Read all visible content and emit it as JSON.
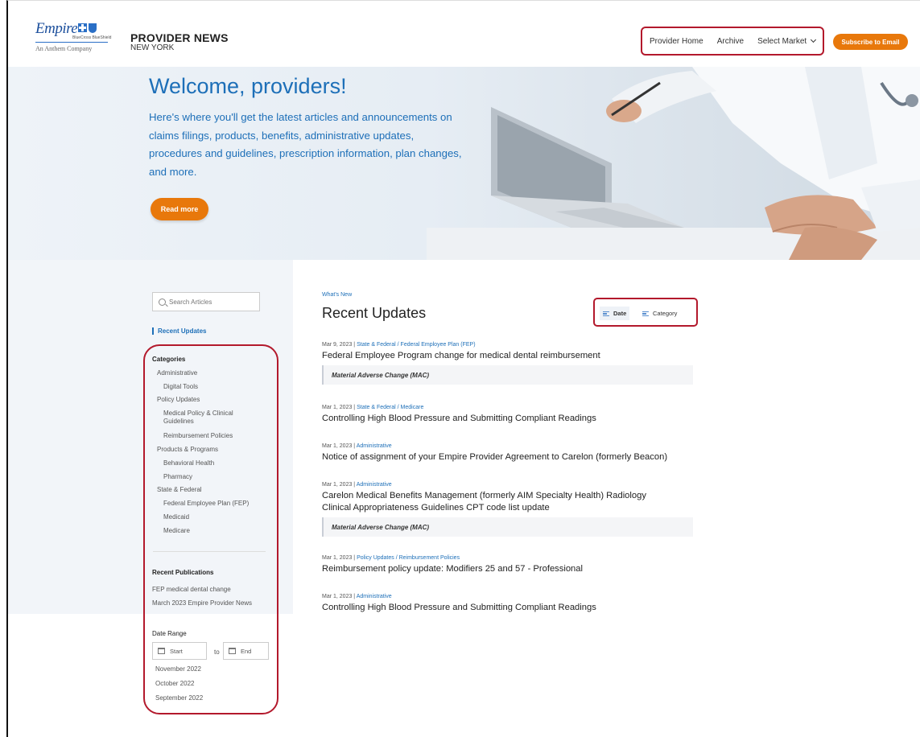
{
  "header": {
    "logo": {
      "wordmark": "Empire",
      "sub": "BlueCross BlueShield",
      "tagline": "An Anthem Company"
    },
    "title": "PROVIDER NEWS",
    "subtitle": "NEW YORK",
    "nav": {
      "home": "Provider Home",
      "archive": "Archive",
      "market": "Select Market"
    },
    "subscribe_label": "Subscribe to Email"
  },
  "hero": {
    "title": "Welcome, providers!",
    "text": "Here's where you'll get the latest articles and announcements on claims filings, products, benefits, administrative updates, procedures and guidelines, prescription information, plan changes, and more.",
    "button": "Read more"
  },
  "sidebar": {
    "search_placeholder": "Search Articles",
    "recent_updates": "Recent Updates",
    "categories_heading": "Categories",
    "categories": {
      "administrative": "Administrative",
      "digital_tools": "Digital Tools",
      "policy_updates": "Policy Updates",
      "medical_policy_line1": "Medical Policy & Clinical",
      "medical_policy_line2": "Guidelines",
      "reimbursement": "Reimbursement Policies",
      "products": "Products & Programs",
      "behavioral": "Behavioral Health",
      "pharmacy": "Pharmacy",
      "state_federal": "State & Federal",
      "fep": "Federal Employee Plan (FEP)",
      "medicaid": "Medicaid",
      "medicare": "Medicare"
    },
    "publications_heading": "Recent Publications",
    "publications": [
      "FEP medical dental change",
      "March 2023 Empire Provider News"
    ],
    "date_range_heading": "Date Range",
    "start_placeholder": "Start",
    "to_label": "to",
    "end_placeholder": "End",
    "months": [
      "November 2022",
      "October 2022",
      "September 2022"
    ]
  },
  "main": {
    "breadcrumb": "What's New",
    "title": "Recent Updates",
    "sort": {
      "date": "Date",
      "category": "Category"
    },
    "articles": [
      {
        "date": "Mar 9, 2023 | ",
        "category": "State & Federal / Federal Employee Plan (FEP)",
        "title": "Federal Employee Program change for medical dental reimbursement",
        "tag": "Material Adverse Change (MAC)"
      },
      {
        "date": "Mar 1, 2023 | ",
        "category": "State & Federal / Medicare",
        "title": "Controlling High Blood Pressure and Submitting Compliant Readings"
      },
      {
        "date": "Mar 1, 2023 | ",
        "category": "Administrative",
        "title": "Notice of assignment of your Empire Provider Agreement to Carelon (formerly Beacon)"
      },
      {
        "date": "Mar 1, 2023 | ",
        "category": "Administrative",
        "title_line1": "Carelon Medical Benefits Management (formerly AIM Specialty Health) Radiology",
        "title_line2": "Clinical Appropriateness Guidelines CPT code list update",
        "tag": "Material Adverse Change (MAC)"
      },
      {
        "date": "Mar 1, 2023 | ",
        "category": "Policy Updates / Reimbursement Policies",
        "title": "Reimbursement policy update: Modifiers 25 and 57 - Professional"
      },
      {
        "date": "Mar 1, 2023 | ",
        "category": "Administrative",
        "title": "Controlling High Blood Pressure and Submitting Compliant Readings"
      }
    ]
  },
  "colors": {
    "accent_blue": "#1d6fb8",
    "orange": "#e8780b",
    "highlight_red": "#b3192c"
  }
}
